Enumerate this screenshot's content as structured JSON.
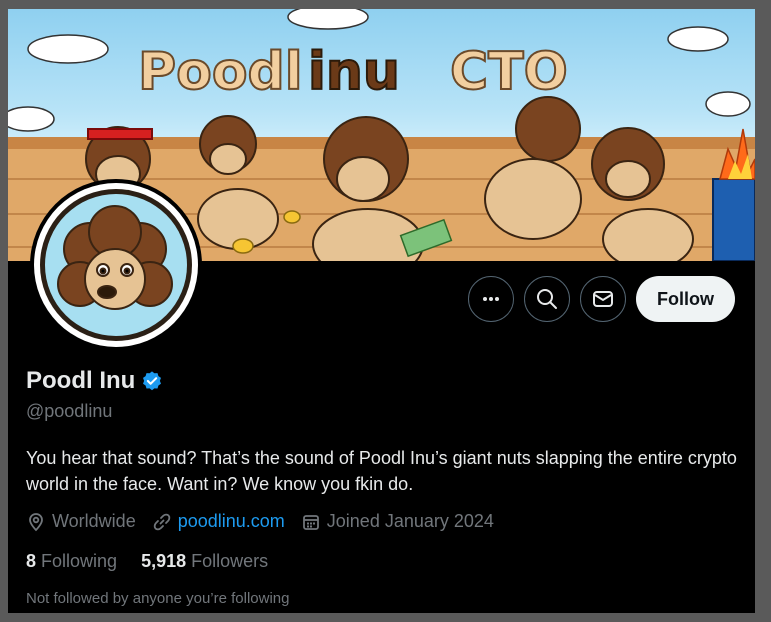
{
  "banner": {
    "title_text": "Poodl inu CTO"
  },
  "actions": {
    "more_icon": "more-horizontal-icon",
    "search_icon": "search-icon",
    "message_icon": "mail-icon",
    "follow_label": "Follow"
  },
  "profile": {
    "name": "Poodl Inu",
    "verified": true,
    "handle": "@poodlinu",
    "bio": "You hear that sound? That’s the sound of Poodl Inu’s giant nuts slapping the entire crypto world in the face. Want in? We know you fkin do.",
    "location": "Worldwide",
    "website": "poodlinu.com",
    "joined": "Joined January 2024",
    "following_count": "8",
    "following_label": "Following",
    "followers_count": "5,918",
    "followers_label": "Followers",
    "not_followed_note": "Not followed by anyone you’re following"
  },
  "colors": {
    "accent": "#1d9bf0",
    "background": "#000000",
    "muted": "#71767b",
    "verified": "#1d9bf0"
  }
}
